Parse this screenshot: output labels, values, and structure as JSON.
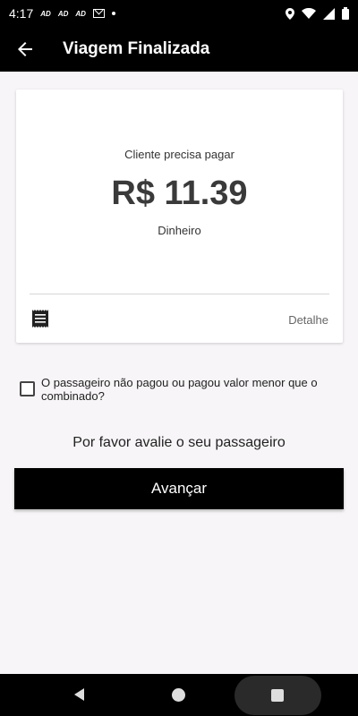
{
  "status": {
    "time": "4:17",
    "notif_1": "AD",
    "notif_2": "AD",
    "notif_3": "AD"
  },
  "app_bar": {
    "title": "Viagem Finalizada"
  },
  "card": {
    "label": "Cliente precisa pagar",
    "amount": "R$ 11.39",
    "payment_method": "Dinheiro",
    "detail_link": "Detalhe"
  },
  "checkbox": {
    "label": "O passageiro não pagou ou pagou valor menor que o combinado?",
    "checked": false
  },
  "rate_prompt": "Por favor avalie o seu passageiro",
  "advance_button": "Avançar",
  "colors": {
    "app_bar": "#000000",
    "background": "#f7f5f7",
    "button": "#000000"
  }
}
